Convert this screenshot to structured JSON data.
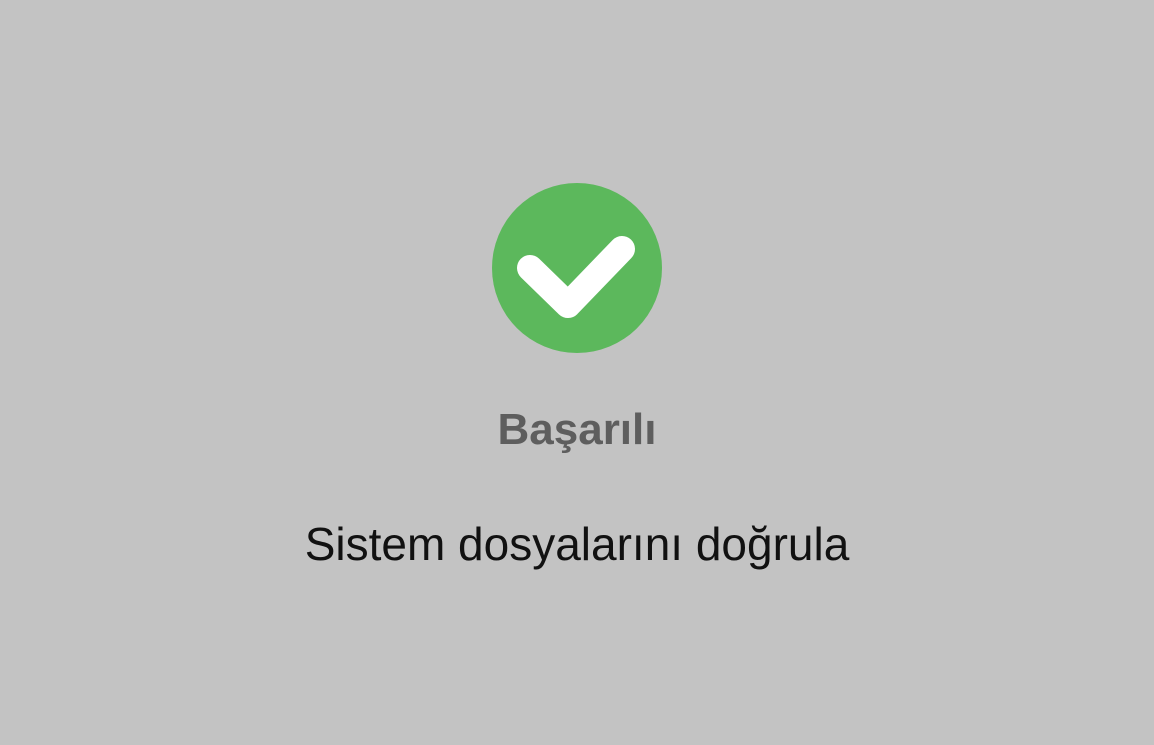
{
  "status": {
    "icon": "checkmark-circle-icon",
    "icon_color": "#5cb85c",
    "check_color": "#ffffff",
    "title": "Başarılı",
    "message": "Sistem dosyalarını doğrula"
  },
  "colors": {
    "background": "#c3c3c3",
    "title": "#5e5e5e",
    "message": "#111111"
  }
}
